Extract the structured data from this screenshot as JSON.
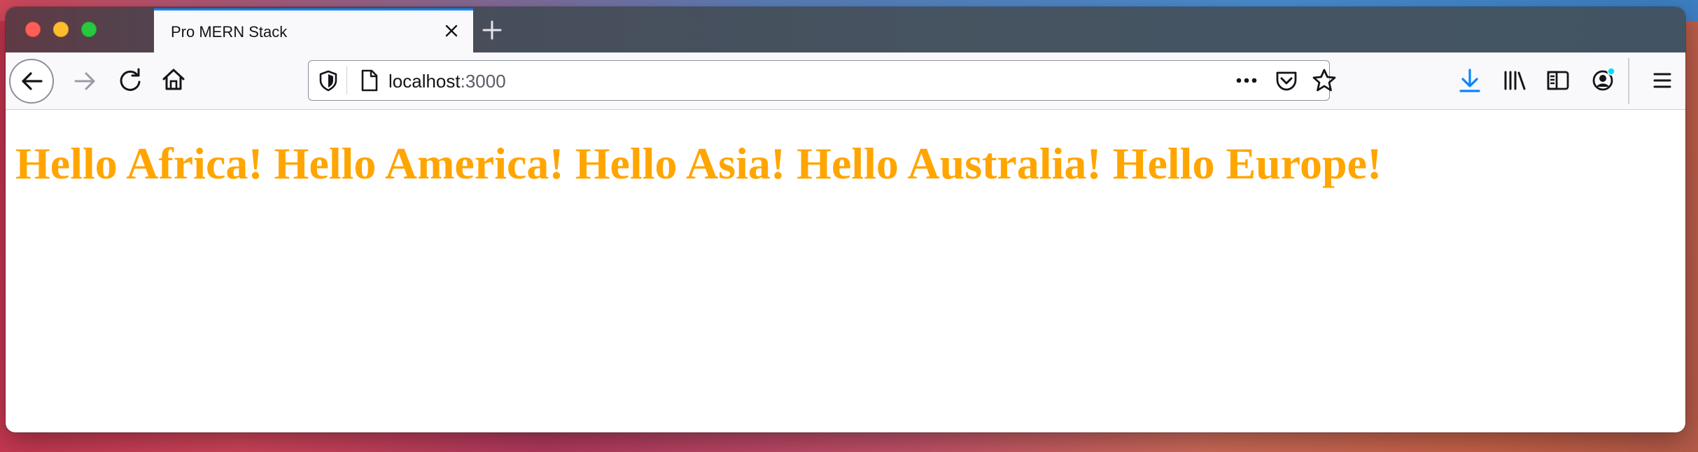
{
  "browser": {
    "tab": {
      "title": "Pro MERN Stack"
    },
    "address_bar": {
      "host": "localhost",
      "port": ":3000"
    },
    "icons": {
      "back": "arrow-left-icon",
      "forward": "arrow-right-icon",
      "reload": "reload-icon",
      "home": "home-icon",
      "tracking_protection": "shield-icon",
      "page_info": "page-icon",
      "page_actions": "more-horizontal-icon",
      "pocket": "pocket-icon",
      "bookmark": "star-icon",
      "downloads": "download-icon",
      "library": "library-icon",
      "sidebar": "sidebar-icon",
      "account": "account-icon",
      "menu": "hamburger-menu-icon"
    },
    "colors": {
      "accent": "#0a84ff",
      "download_active": "#0a84ff",
      "account_badge": "#00ddff"
    }
  },
  "page": {
    "heading": "Hello Africa! Hello America! Hello Asia! Hello Australia! Hello Europe!",
    "heading_color": "#ffa500"
  }
}
